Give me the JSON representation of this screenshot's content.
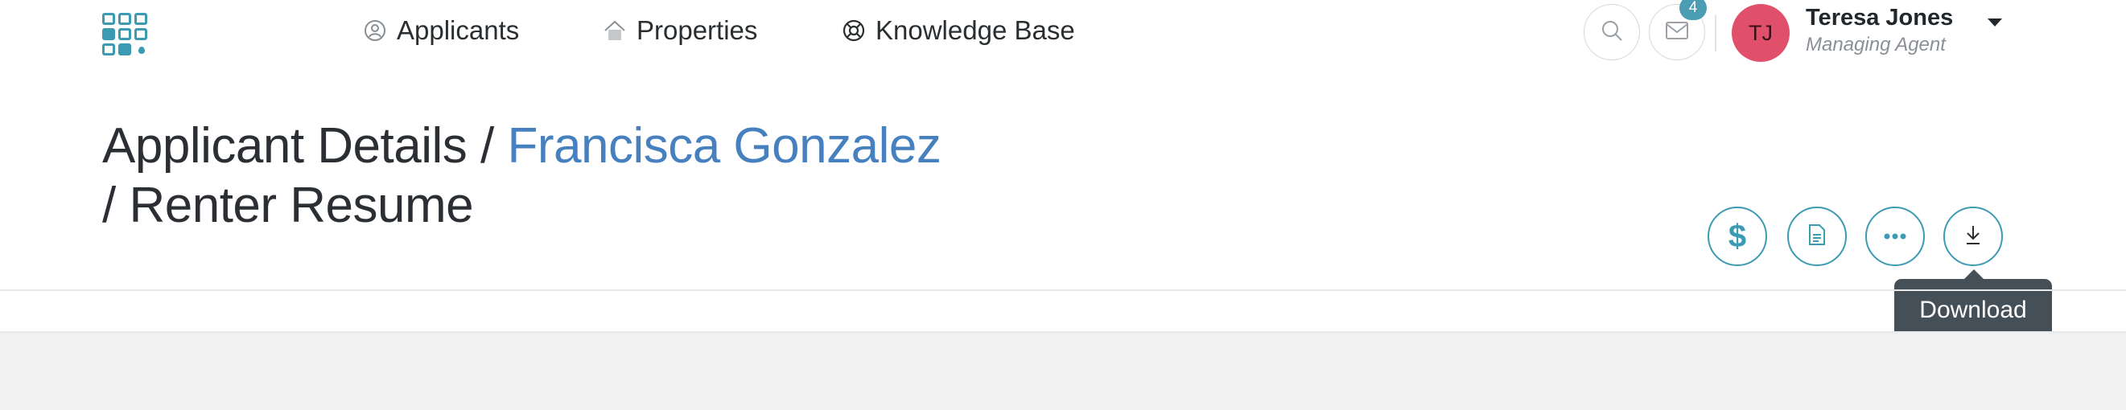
{
  "nav": {
    "items": [
      {
        "label": "Applicants",
        "icon": "user-circle-icon"
      },
      {
        "label": "Properties",
        "icon": "home-icon"
      },
      {
        "label": "Knowledge Base",
        "icon": "lifebuoy-icon"
      }
    ]
  },
  "header": {
    "notification_count": "4",
    "user": {
      "initials": "TJ",
      "name": "Teresa Jones",
      "role": "Managing Agent"
    }
  },
  "page": {
    "title_prefix": "Applicant Details / ",
    "applicant_name": "Francisca Gonzalez",
    "title_suffix": "/ Renter Resume"
  },
  "actions": {
    "tooltip": "Download",
    "buttons": [
      "dollar-icon",
      "document-icon",
      "more-icon",
      "download-icon"
    ]
  },
  "colors": {
    "accent": "#3c9bb3",
    "link": "#4780be",
    "avatar": "#e0506a",
    "tooltip_bg": "#454f58"
  }
}
